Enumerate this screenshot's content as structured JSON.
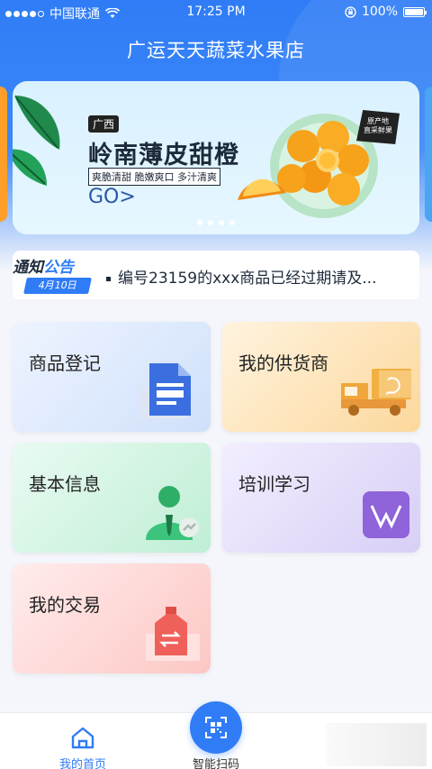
{
  "status_bar": {
    "carrier": "中国联通",
    "time": "17:25 PM",
    "battery": "100%"
  },
  "header": {
    "title": "广运天天蔬菜水果店"
  },
  "banner": {
    "tag": "广西",
    "title": "岭南薄皮甜橙",
    "subtitle": "爽脆清甜 脆嫩爽口 多汁清爽",
    "cta": "GO>",
    "badge_line1": "原产地",
    "badge_line2": "直采鲜果",
    "slide_count": 4,
    "active_slide": 1
  },
  "notice": {
    "label_part1": "通知",
    "label_part2": "公告",
    "date": "4月10日",
    "text": "编号23159的xxx商品已经过期请及..."
  },
  "menu": {
    "product_register": "商品登记",
    "my_suppliers": "我的供货商",
    "basic_info": "基本信息",
    "training": "培训学习",
    "my_trades": "我的交易"
  },
  "tabbar": {
    "home": "我的首页",
    "scan": "智能扫码"
  },
  "colors": {
    "primary": "#2f7cf6",
    "orange": "#f5a623",
    "green": "#3cc47c",
    "purple": "#8f63d9",
    "red": "#f0605a"
  }
}
